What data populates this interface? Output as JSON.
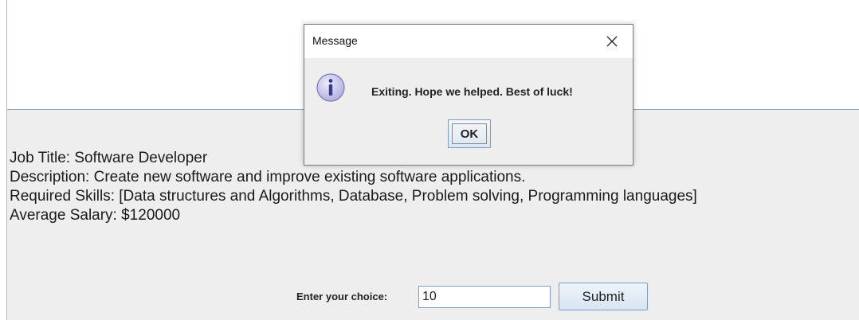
{
  "job": {
    "title_line": "Job Title: Software Developer",
    "description_line": "Description: Create new software and improve existing software applications.",
    "skills_line": "Required Skills: [Data structures and Algorithms, Database, Problem solving, Programming languages]",
    "salary_line": "Average Salary: $120000"
  },
  "form": {
    "choice_label": "Enter your choice:",
    "choice_value": "10",
    "submit_label": "Submit"
  },
  "dialog": {
    "title": "Message",
    "close_icon": "close-icon",
    "message_icon": "info-icon",
    "message": "Exiting. Hope we helped. Best of luck!",
    "ok_label": "OK"
  },
  "colors": {
    "panel_bg": "#eeeeee",
    "accent_border": "#7a9cc6",
    "info_icon_fill": "#c9c8ea"
  }
}
